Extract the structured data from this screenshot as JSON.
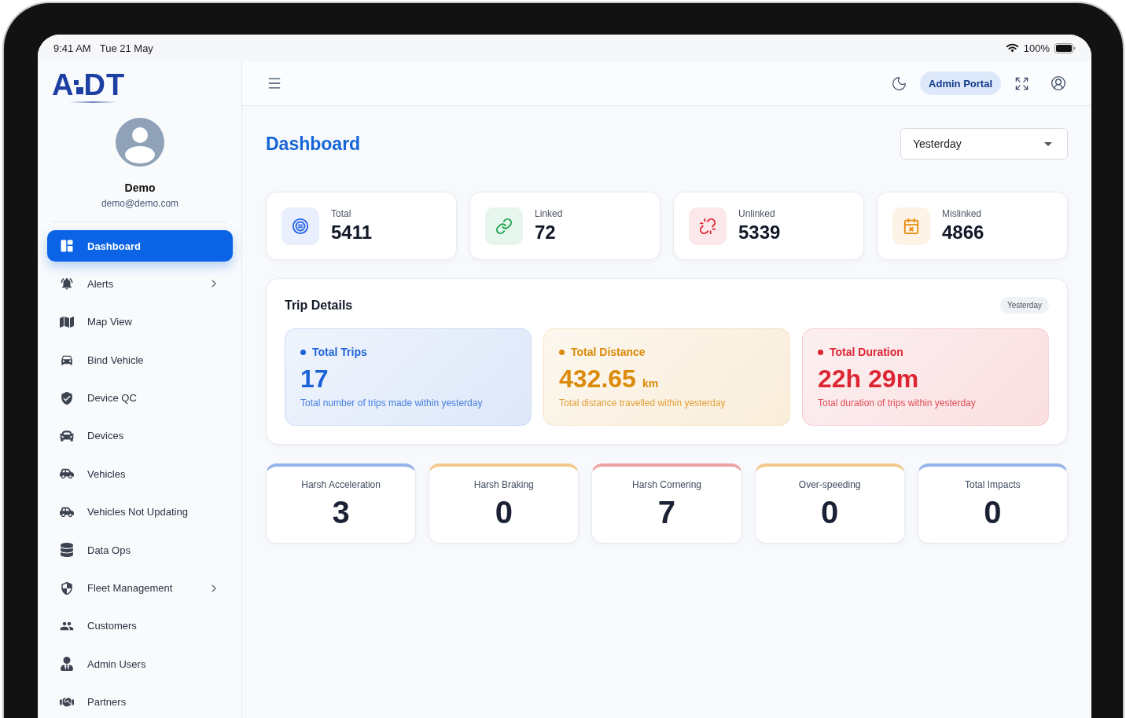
{
  "status_bar": {
    "time": "9:41 AM",
    "date": "Tue 21 May",
    "battery": "100%"
  },
  "sidebar": {
    "logo": {
      "parts": [
        "A",
        "DT"
      ]
    },
    "user": {
      "name": "Demo",
      "email": "demo@demo.com"
    },
    "items": [
      {
        "label": "Dashboard",
        "selected": true,
        "has_submenu": false
      },
      {
        "label": "Alerts",
        "selected": false,
        "has_submenu": true
      },
      {
        "label": "Map View",
        "selected": false,
        "has_submenu": false
      },
      {
        "label": "Bind Vehicle",
        "selected": false,
        "has_submenu": false
      },
      {
        "label": "Device QC",
        "selected": false,
        "has_submenu": false
      },
      {
        "label": "Devices",
        "selected": false,
        "has_submenu": false
      },
      {
        "label": "Vehicles",
        "selected": false,
        "has_submenu": false
      },
      {
        "label": "Vehicles Not Updating",
        "selected": false,
        "has_submenu": false
      },
      {
        "label": "Data Ops",
        "selected": false,
        "has_submenu": false
      },
      {
        "label": "Fleet Management",
        "selected": false,
        "has_submenu": true
      },
      {
        "label": "Customers",
        "selected": false,
        "has_submenu": false
      },
      {
        "label": "Admin Users",
        "selected": false,
        "has_submenu": false
      },
      {
        "label": "Partners",
        "selected": false,
        "has_submenu": false
      }
    ]
  },
  "header": {
    "portal_button": "Admin Portal"
  },
  "page": {
    "title": "Dashboard",
    "period_select": {
      "value": "Yesterday"
    }
  },
  "stats": [
    {
      "label": "Total",
      "value": "5411",
      "color": "#2563eb"
    },
    {
      "label": "Linked",
      "value": "72",
      "color": "#16a34a"
    },
    {
      "label": "Unlinked",
      "value": "5339",
      "color": "#e11d2e"
    },
    {
      "label": "Mislinked",
      "value": "4866",
      "color": "#ea8a0c"
    }
  ],
  "trip_details": {
    "title": "Trip Details",
    "badge": "Yesterday",
    "cards": [
      {
        "title": "Total Trips",
        "value": "17",
        "description": "Total number of trips made within yesterday",
        "color": "#1d63d8"
      },
      {
        "title": "Total Distance",
        "value": "432.65",
        "unit": "km",
        "description": "Total distance travelled within yesterday",
        "color": "#db8a0a"
      },
      {
        "title": "Total Duration",
        "value": "22h 29m",
        "description": "Total duration of trips within yesterday",
        "color": "#dc2633"
      }
    ]
  },
  "events": [
    {
      "label": "Harsh Acceleration",
      "value": "3",
      "color": "#93b3ea"
    },
    {
      "label": "Harsh Braking",
      "value": "0",
      "color": "#f2c98a"
    },
    {
      "label": "Harsh Cornering",
      "value": "7",
      "color": "#eea3a3"
    },
    {
      "label": "Over-speeding",
      "value": "0",
      "color": "#f2c98a"
    },
    {
      "label": "Total Impacts",
      "value": "0",
      "color": "#93b3ea"
    }
  ]
}
